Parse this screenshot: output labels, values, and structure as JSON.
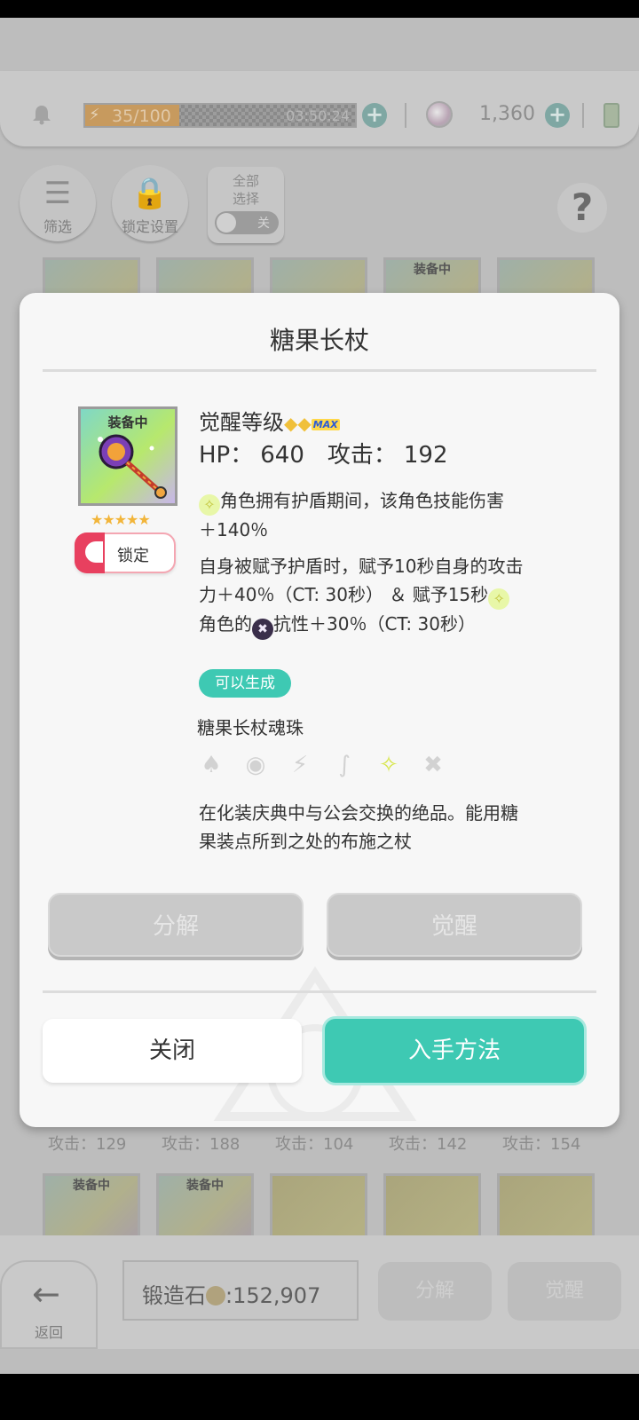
{
  "resources": {
    "stamina": "35/100",
    "stamina_fill": 0.35,
    "stamina_timer": "03:50:24",
    "gems": "1,360"
  },
  "toolbar": {
    "filter_label": "筛选",
    "lock_settings_label": "锁定设置",
    "select_all_label": "全部\n选择",
    "toggle_state": "关"
  },
  "background": {
    "equipped_badge": "装备中",
    "stats": [
      "攻击：129",
      "攻击：188",
      "攻击：104",
      "攻击：142",
      "攻击：154"
    ]
  },
  "bottom_bar": {
    "back_label": "返回",
    "forge_label": "锻造石",
    "forge_value": ":152,907",
    "dismantle_label": "分解",
    "awaken_label": "觉醒"
  },
  "modal": {
    "title": "糖果长杖",
    "equipped_badge": "装备中",
    "star_count": 5,
    "lock_label": "锁定",
    "awaken_level_label": "觉醒等级",
    "max_label": "MAX",
    "hp_label": "HP：",
    "hp_value": "640",
    "atk_label": "攻击：",
    "atk_value": "192",
    "skill1_line1": "角色拥有护盾期间，该角色技能伤害",
    "skill1_line2": "＋140％",
    "skill2_line1": "自身被赋予护盾时，赋予10秒自身的攻击",
    "skill2_line2": "力＋40％（CT: 30秒） ＆ 赋予15秒",
    "skill2_line3a": "角色的",
    "skill2_line3b": "抗性＋30％（CT: 30秒）",
    "can_generate": "可以生成",
    "soul_orb": "糖果长杖魂珠",
    "attributes": [
      "fire-icon",
      "water-icon",
      "lightning-icon",
      "wind-icon",
      "light-icon",
      "dark-icon"
    ],
    "active_attribute": "light-icon",
    "flavor_line1": "在化装庆典中与公会交换的绝品。能用糖",
    "flavor_line2": "果装点所到之处的布施之杖",
    "dismantle_label": "分解",
    "awaken_label": "觉醒",
    "close_label": "关闭",
    "obtain_label": "入手方法"
  }
}
